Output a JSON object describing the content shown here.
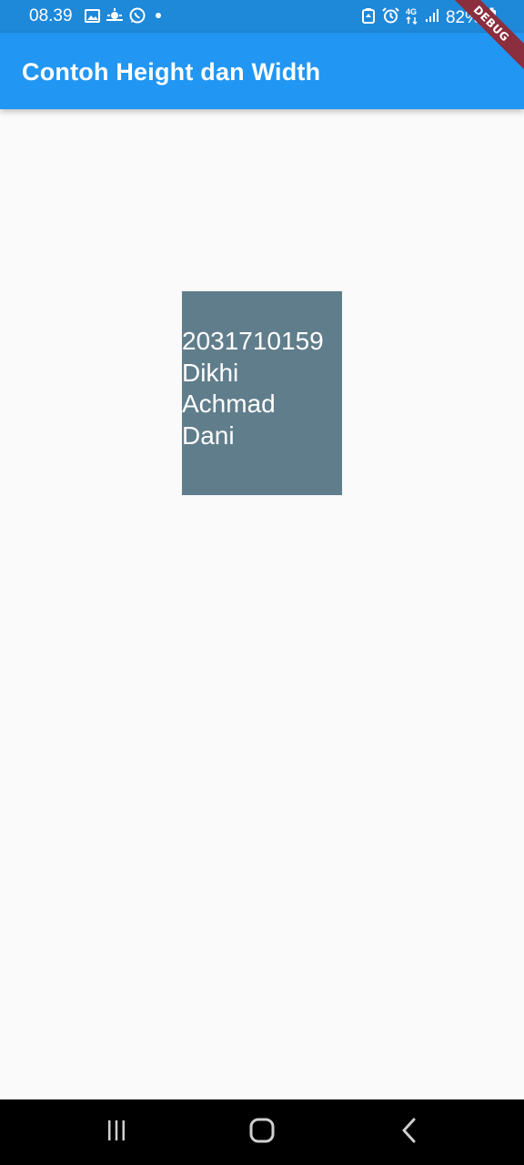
{
  "status_bar": {
    "time": "08.39",
    "network": "4G",
    "battery": "82%",
    "left_icons": [
      "gallery-icon",
      "weather-icon",
      "whatsapp-icon",
      "dot-icon"
    ],
    "right_icons": [
      "battery-saver-icon",
      "alarm-icon",
      "network-4g-icon",
      "signal-icon",
      "battery-charging-icon"
    ]
  },
  "app_bar": {
    "title": "Contoh Height dan Width",
    "color": "#2196F3"
  },
  "debug_banner": {
    "label": "DEBUG"
  },
  "box": {
    "text": "2031710159\nDikhi\nAchmad\nDani",
    "color": "#607D8B"
  },
  "nav_bar": {
    "buttons": [
      "recent-apps-icon",
      "home-icon",
      "back-icon"
    ]
  }
}
